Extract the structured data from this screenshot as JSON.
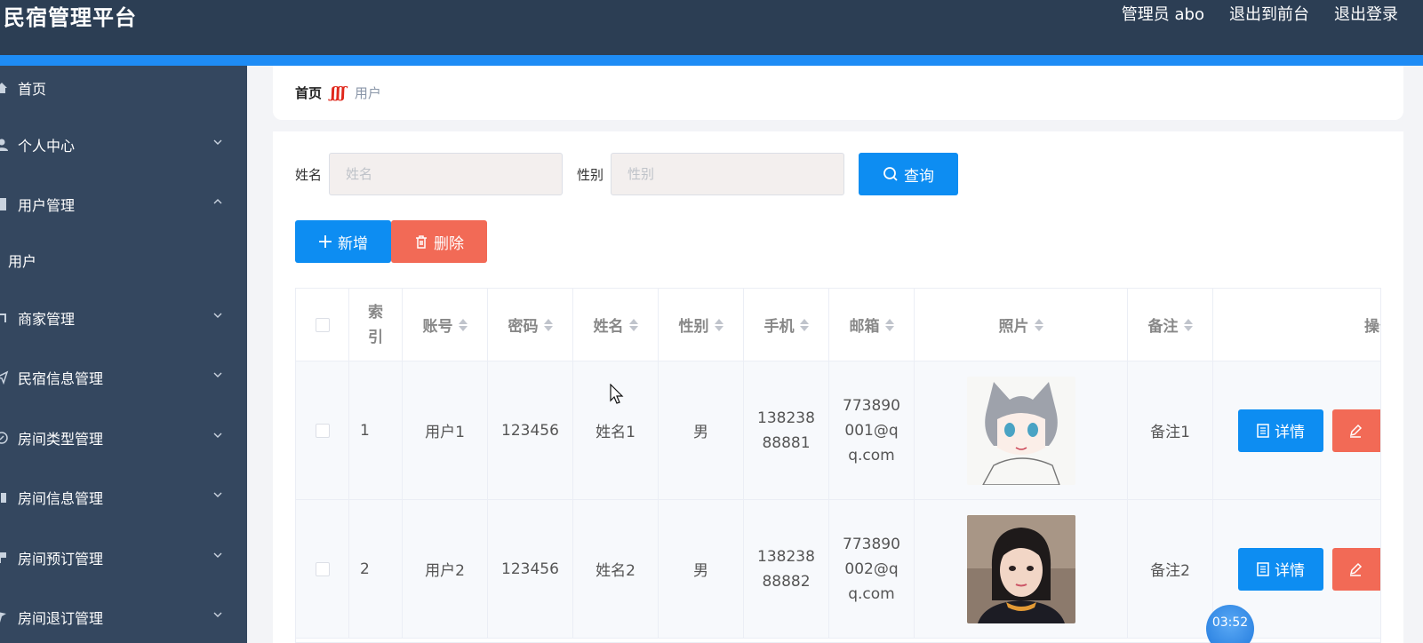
{
  "header": {
    "title": "民宿管理平台",
    "nav": [
      "管理员 abo",
      "退出到前台",
      "退出登录"
    ]
  },
  "sidebar": {
    "items": [
      {
        "label": "首页",
        "icon": "home-icon"
      },
      {
        "label": "个人中心",
        "icon": "user-icon"
      },
      {
        "label": "用户管理",
        "icon": "document-icon"
      },
      {
        "label": "用户",
        "icon": ""
      },
      {
        "label": "商家管理",
        "icon": "shop-icon"
      },
      {
        "label": "民宿信息管理",
        "icon": "send-icon"
      },
      {
        "label": "房间类型管理",
        "icon": "compass-icon"
      },
      {
        "label": "房间信息管理",
        "icon": "building-icon"
      },
      {
        "label": "房间预订管理",
        "icon": "bookmark-icon"
      },
      {
        "label": "房间退订管理",
        "icon": "flag-icon"
      }
    ]
  },
  "breadcrumb": {
    "home": "首页",
    "separator": "ʃʃʃ",
    "current": "用户"
  },
  "search": {
    "name_label": "姓名",
    "name_placeholder": "姓名",
    "gender_label": "性别",
    "gender_placeholder": "性别",
    "query_label": "查询"
  },
  "actions": {
    "add_label": "新增",
    "delete_label": "删除"
  },
  "table": {
    "headers": [
      "索引",
      "账号",
      "密码",
      "姓名",
      "性别",
      "手机",
      "邮箱",
      "照片",
      "备注",
      "操作"
    ],
    "rows": [
      {
        "index": "1",
        "account": "用户1",
        "password": "123456",
        "name": "姓名1",
        "gender": "男",
        "phone": "13823888881",
        "email": "773890001@qq.com",
        "remark": "备注1"
      },
      {
        "index": "2",
        "account": "用户2",
        "password": "123456",
        "name": "姓名2",
        "gender": "男",
        "phone": "13823888882",
        "email": "773890002@qq.com",
        "remark": "备注2"
      }
    ],
    "detail_label": "详情"
  },
  "timer": "03:52"
}
